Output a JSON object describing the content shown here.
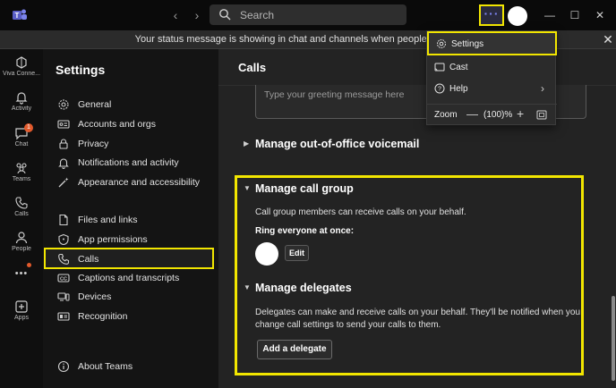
{
  "titlebar": {
    "search_placeholder": "Search",
    "more_label": "···"
  },
  "banner": {
    "text": "Your status message is showing in chat and channels when people message or",
    "close": "✕"
  },
  "rail": {
    "items": [
      {
        "label": "Viva Conne...",
        "icon": "viva-connections-icon"
      },
      {
        "label": "Activity",
        "icon": "bell-icon"
      },
      {
        "label": "Chat",
        "icon": "chat-icon",
        "badge": "1"
      },
      {
        "label": "Teams",
        "icon": "teams-icon"
      },
      {
        "label": "Calls",
        "icon": "phone-icon"
      },
      {
        "label": "People",
        "icon": "people-icon"
      },
      {
        "label": "Apps",
        "icon": "plus-square-icon"
      }
    ],
    "more": "•••"
  },
  "settings": {
    "title": "Settings",
    "items": [
      {
        "label": "General",
        "icon": "gear-icon"
      },
      {
        "label": "Accounts and orgs",
        "icon": "id-card-icon"
      },
      {
        "label": "Privacy",
        "icon": "lock-icon"
      },
      {
        "label": "Notifications and activity",
        "icon": "bell-icon"
      },
      {
        "label": "Appearance and accessibility",
        "icon": "wand-icon"
      },
      {
        "label": "Files and links",
        "icon": "file-icon"
      },
      {
        "label": "App permissions",
        "icon": "shield-icon"
      },
      {
        "label": "Calls",
        "icon": "phone-icon"
      },
      {
        "label": "Captions and transcripts",
        "icon": "cc-icon"
      },
      {
        "label": "Devices",
        "icon": "devices-icon"
      },
      {
        "label": "Recognition",
        "icon": "recognition-icon"
      },
      {
        "label": "About Teams",
        "icon": "info-icon"
      }
    ],
    "active": "Calls"
  },
  "main": {
    "title": "Calls",
    "greeting_placeholder": "Type your greeting message here",
    "ooo_voicemail": "Manage out-of-office voicemail",
    "call_group": {
      "heading": "Manage call group",
      "desc": "Call group members can receive calls on your behalf.",
      "ring_label": "Ring everyone at once:",
      "edit": "Edit"
    },
    "delegates": {
      "heading": "Manage delegates",
      "desc_line1": "Delegates can make and receive calls on your behalf. They'll be notified when you",
      "desc_line2": "change call settings to send your calls to them.",
      "add": "Add a delegate"
    }
  },
  "menu": {
    "items": [
      {
        "label": "Settings",
        "icon": "gear-icon"
      },
      {
        "label": "Cast",
        "icon": "cast-icon"
      },
      {
        "label": "Help",
        "icon": "help-icon"
      }
    ],
    "zoom_label": "Zoom",
    "zoom_minus": "—",
    "zoom_value": "(100)%",
    "zoom_plus": "+"
  },
  "colors": {
    "highlight": "#f2e600",
    "accent": "#7f85f5",
    "badge": "#e25a2c"
  }
}
